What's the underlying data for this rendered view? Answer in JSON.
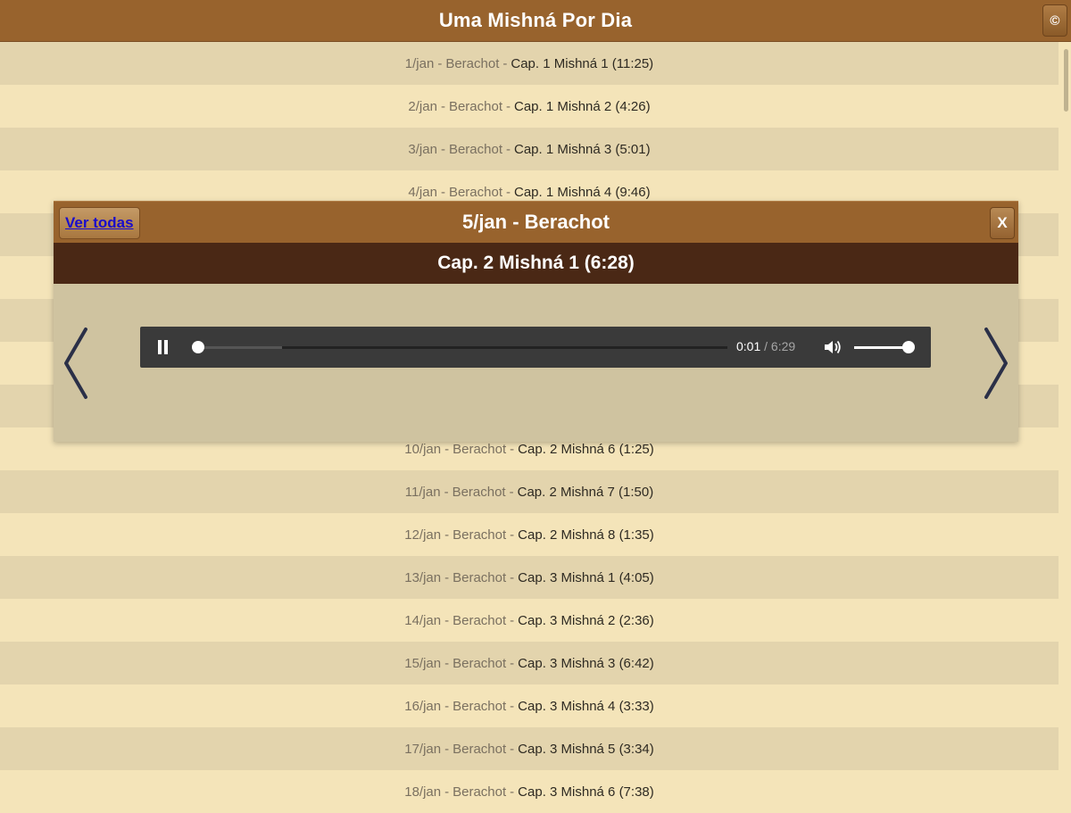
{
  "app": {
    "title": "Uma Mishná Por Dia",
    "header_button_glyph": "©"
  },
  "list": [
    {
      "date": "1/jan",
      "tractate": "Berachot",
      "cap": "Cap. 1 Mishná 1 (11:25)"
    },
    {
      "date": "2/jan",
      "tractate": "Berachot",
      "cap": "Cap. 1 Mishná 2 (4:26)"
    },
    {
      "date": "3/jan",
      "tractate": "Berachot",
      "cap": "Cap. 1 Mishná 3 (5:01)"
    },
    {
      "date": "4/jan",
      "tractate": "Berachot",
      "cap": "Cap. 1 Mishná 4 (9:46)"
    },
    {
      "date": "",
      "tractate": "",
      "cap": ""
    },
    {
      "date": "",
      "tractate": "",
      "cap": ""
    },
    {
      "date": "",
      "tractate": "",
      "cap": ""
    },
    {
      "date": "",
      "tractate": "",
      "cap": ""
    },
    {
      "date": "",
      "tractate": "",
      "cap": ""
    },
    {
      "date": "10/jan",
      "tractate": "Berachot",
      "cap": "Cap. 2 Mishná 6 (1:25)"
    },
    {
      "date": "11/jan",
      "tractate": "Berachot",
      "cap": "Cap. 2 Mishná 7 (1:50)"
    },
    {
      "date": "12/jan",
      "tractate": "Berachot",
      "cap": "Cap. 2 Mishná 8 (1:35)"
    },
    {
      "date": "13/jan",
      "tractate": "Berachot",
      "cap": "Cap. 3 Mishná 1 (4:05)"
    },
    {
      "date": "14/jan",
      "tractate": "Berachot",
      "cap": "Cap. 3 Mishná 2 (2:36)"
    },
    {
      "date": "15/jan",
      "tractate": "Berachot",
      "cap": "Cap. 3 Mishná 3 (6:42)"
    },
    {
      "date": "16/jan",
      "tractate": "Berachot",
      "cap": "Cap. 3 Mishná 4 (3:33)"
    },
    {
      "date": "17/jan",
      "tractate": "Berachot",
      "cap": "Cap. 3 Mishná 5 (3:34)"
    },
    {
      "date": "18/jan",
      "tractate": "Berachot",
      "cap": "Cap. 3 Mishná 6 (7:38)"
    }
  ],
  "list_separator": "-",
  "modal": {
    "ver_todas": "Ver todas",
    "title": "5/jan - Berachot",
    "close_label": "X",
    "subtitle": "Cap. 2 Mishná 1 (6:28)",
    "player": {
      "current_time": "0:01",
      "separator": " / ",
      "total_time": "6:29",
      "progress_fraction": 0.002,
      "volume_fraction": 1.0
    },
    "prev_icon": "chevron-left-icon",
    "next_icon": "chevron-right-icon"
  },
  "colors": {
    "header": "#98632d",
    "subheader": "#4a2815",
    "row_light": "#f4e4b9",
    "row_dark": "#e3d4ad",
    "link": "#1a0dcc"
  }
}
